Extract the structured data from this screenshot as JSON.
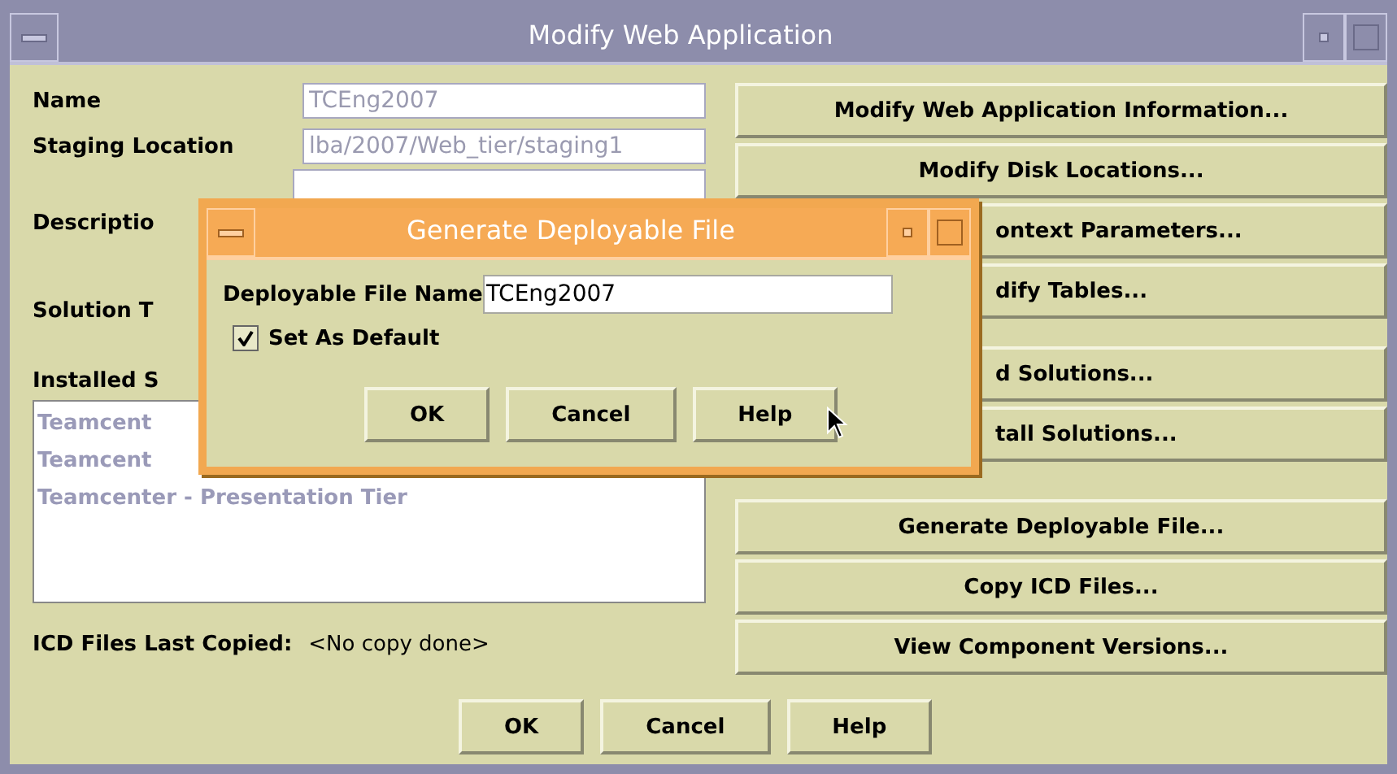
{
  "window": {
    "title": "Modify Web Application"
  },
  "fields": [
    {
      "label": "Name",
      "value": "TCEng2007",
      "disabled": true
    },
    {
      "label": "Staging Location",
      "value": "lba/2007/Web_tier/staging1",
      "disabled": true
    }
  ],
  "description": {
    "label": "Descriptio"
  },
  "solution_type": {
    "label": "Solution T"
  },
  "installed_solutions": {
    "label": "Installed S",
    "items": [
      "Teamcent",
      "Teamcent",
      "Teamcenter - Presentation Tier"
    ]
  },
  "icd_status": {
    "label": "ICD Files Last Copied:",
    "value": "<No copy done>"
  },
  "action_groups": [
    [
      {
        "label": "Modify Web Application Information...",
        "cut": false
      },
      {
        "label": "Modify Disk Locations...",
        "cut": false
      },
      {
        "label": "ontext Parameters...",
        "cut": true
      },
      {
        "label": "dify Tables...",
        "cut": true
      }
    ],
    [
      {
        "label": "d Solutions...",
        "cut": true
      },
      {
        "label": "tall Solutions...",
        "cut": true
      }
    ],
    [
      {
        "label": "Generate Deployable File...",
        "cut": false
      },
      {
        "label": "Copy ICD Files...",
        "cut": false
      },
      {
        "label": "View Component Versions...",
        "cut": false
      }
    ]
  ],
  "buttons": [
    "OK",
    "Cancel",
    "Help"
  ],
  "dialog": {
    "title": "Generate Deployable File",
    "field_label": "Deployable File Name",
    "field_value": "TCEng2007",
    "checkbox": {
      "label": "Set As Default",
      "checked": true
    },
    "buttons": [
      "OK",
      "Cancel",
      "Help"
    ]
  }
}
